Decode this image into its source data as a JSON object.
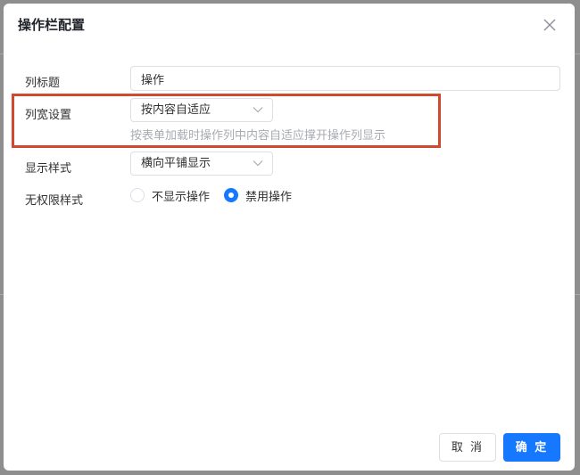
{
  "dialog": {
    "title": "操作栏配置",
    "close_icon": "close-icon"
  },
  "form": {
    "column_title": {
      "label": "列标题",
      "value": "操作"
    },
    "column_width": {
      "label": "列宽设置",
      "selected": "按内容自适应",
      "hint": "按表单加载时操作列中内容自适应撑开操作列显示"
    },
    "display_style": {
      "label": "显示样式",
      "selected": "横向平铺显示"
    },
    "no_permission_style": {
      "label": "无权限样式",
      "options": [
        {
          "label": "不显示操作",
          "checked": false
        },
        {
          "label": "禁用操作",
          "checked": true
        }
      ]
    }
  },
  "footer": {
    "cancel_label": "取 消",
    "confirm_label": "确 定"
  },
  "colors": {
    "primary": "#1677ff",
    "highlight": "#d14a2f"
  }
}
